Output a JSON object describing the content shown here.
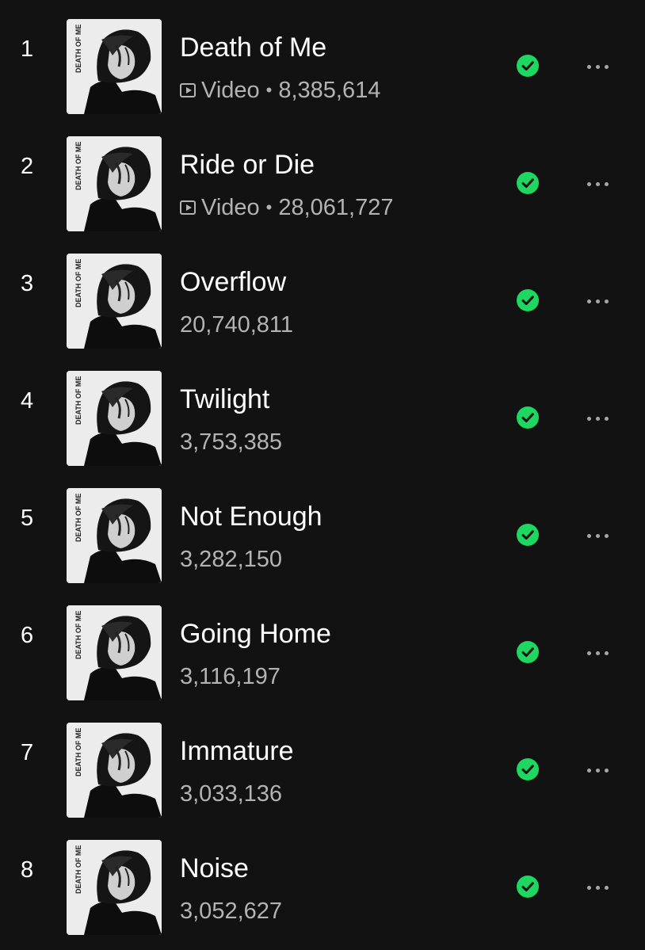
{
  "tracks": [
    {
      "number": "1",
      "title": "Death of Me",
      "has_video": true,
      "video_label": "Video",
      "separator": "•",
      "plays": "8,385,614",
      "saved": true,
      "saved_icon": "check-circle-icon",
      "more_icon": "more-options-icon"
    },
    {
      "number": "2",
      "title": "Ride or Die",
      "has_video": true,
      "video_label": "Video",
      "separator": "•",
      "plays": "28,061,727",
      "saved": true,
      "saved_icon": "check-circle-icon",
      "more_icon": "more-options-icon"
    },
    {
      "number": "3",
      "title": "Overflow",
      "has_video": false,
      "plays": "20,740,811",
      "saved": true,
      "saved_icon": "check-circle-icon",
      "more_icon": "more-options-icon"
    },
    {
      "number": "4",
      "title": "Twilight",
      "has_video": false,
      "plays": "3,753,385",
      "saved": true,
      "saved_icon": "check-circle-icon",
      "more_icon": "more-options-icon"
    },
    {
      "number": "5",
      "title": "Not Enough",
      "has_video": false,
      "plays": "3,282,150",
      "saved": true,
      "saved_icon": "check-circle-icon",
      "more_icon": "more-options-icon"
    },
    {
      "number": "6",
      "title": "Going Home",
      "has_video": false,
      "plays": "3,116,197",
      "saved": true,
      "saved_icon": "check-circle-icon",
      "more_icon": "more-options-icon"
    },
    {
      "number": "7",
      "title": "Immature",
      "has_video": false,
      "plays": "3,033,136",
      "saved": true,
      "saved_icon": "check-circle-icon",
      "more_icon": "more-options-icon"
    },
    {
      "number": "8",
      "title": "Noise",
      "has_video": false,
      "plays": "3,052,627",
      "saved": true,
      "saved_icon": "check-circle-icon",
      "more_icon": "more-options-icon"
    }
  ],
  "cover_art_text": "DEATH OF ME",
  "colors": {
    "background": "#121212",
    "title": "#ffffff",
    "meta": "#b3b3b3",
    "saved_accent": "#1ed760"
  }
}
